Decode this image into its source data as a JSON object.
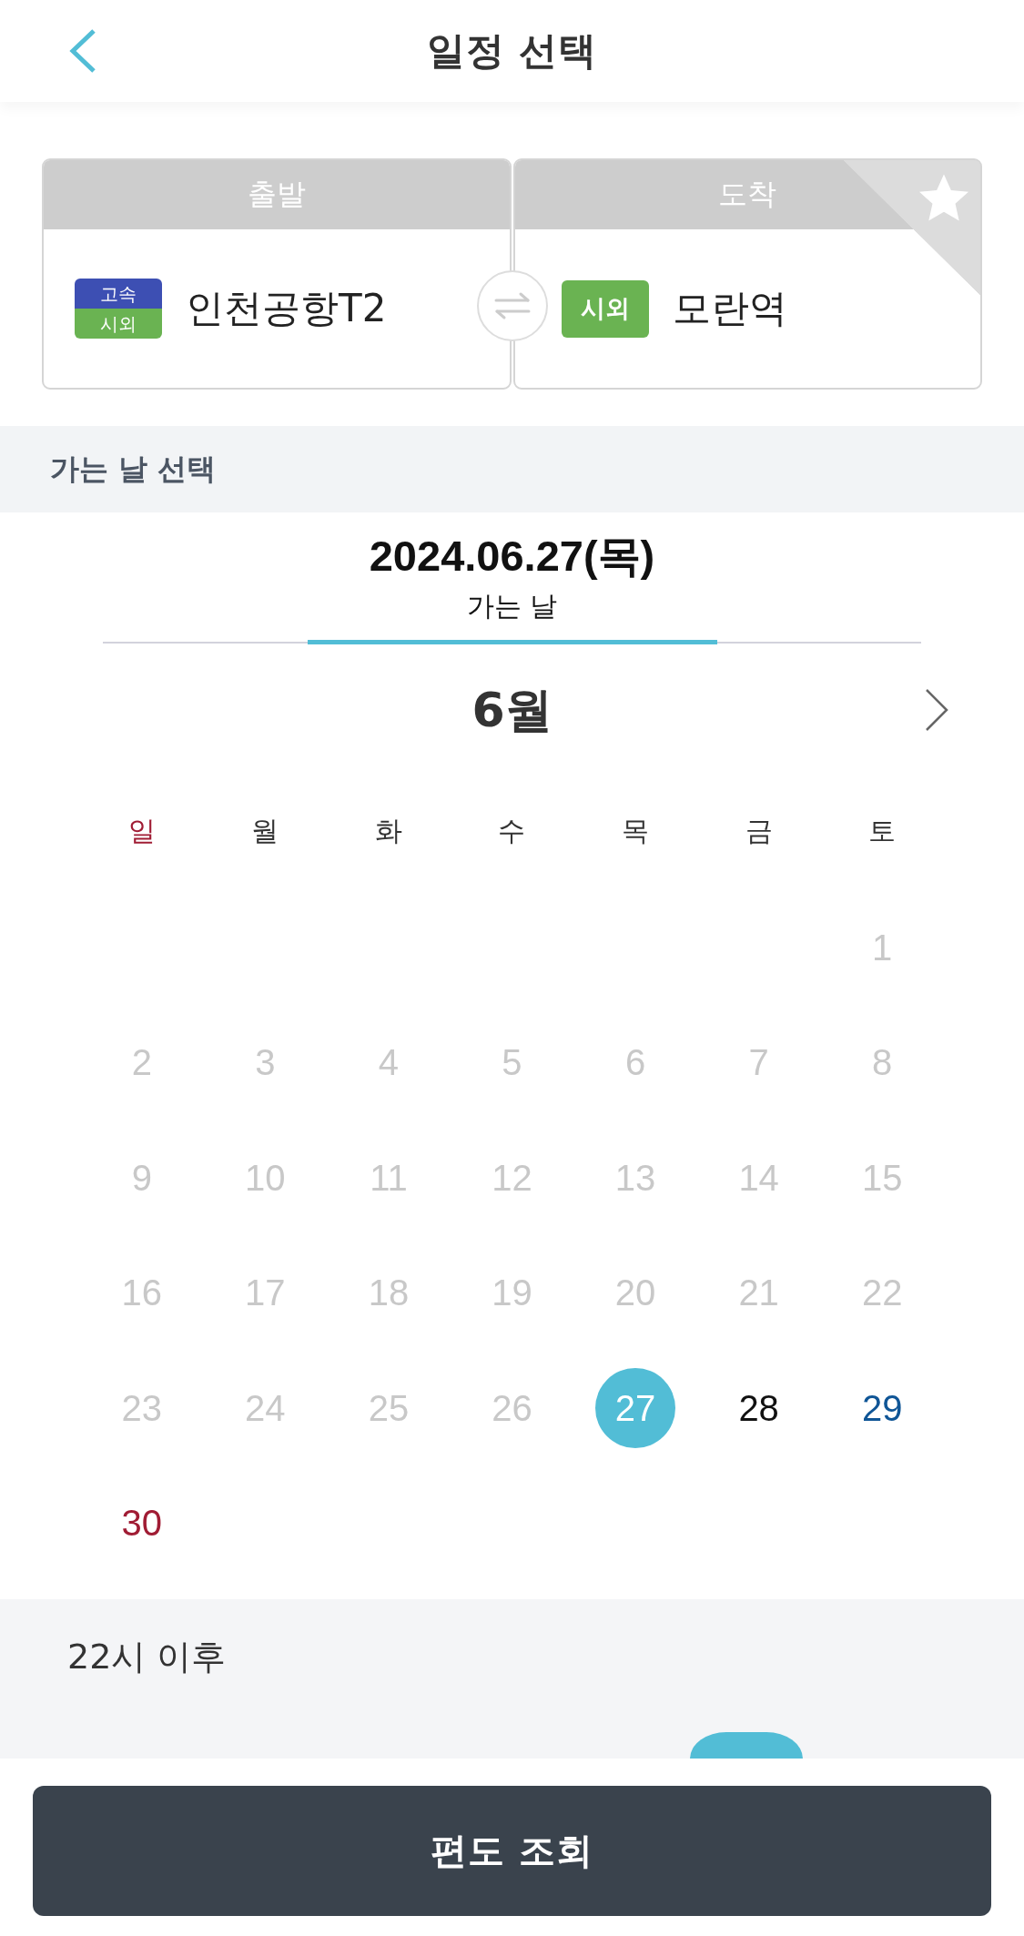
{
  "header": {
    "title": "일정 선택"
  },
  "route": {
    "departure": {
      "label": "출발",
      "badges": [
        {
          "text": "고속",
          "color": "#3d4fb3"
        },
        {
          "text": "시외",
          "color": "#6ab352"
        }
      ],
      "name": "인천공항T2"
    },
    "arrival": {
      "label": "도착",
      "badges": [
        {
          "text": "시외",
          "color": "#6ab352"
        }
      ],
      "name": "모란역",
      "favorite": false
    }
  },
  "section_title": "가는 날 선택",
  "trip_tab": {
    "date": "2024.06.27(목)",
    "label": "가는 날",
    "selected": true
  },
  "calendar": {
    "month": "6월",
    "weekdays": [
      {
        "label": "일",
        "kind": "sunday"
      },
      {
        "label": "월",
        "kind": "weekday"
      },
      {
        "label": "화",
        "kind": "weekday"
      },
      {
        "label": "수",
        "kind": "weekday"
      },
      {
        "label": "목",
        "kind": "weekday"
      },
      {
        "label": "금",
        "kind": "weekday"
      },
      {
        "label": "토",
        "kind": "weekday"
      }
    ],
    "weeks": [
      [
        {
          "kind": "blank"
        },
        {
          "kind": "blank"
        },
        {
          "kind": "blank"
        },
        {
          "kind": "blank"
        },
        {
          "kind": "blank"
        },
        {
          "kind": "blank"
        },
        {
          "label": "1",
          "kind": "saturday",
          "disabled": true,
          "selected": false
        }
      ],
      [
        {
          "label": "2",
          "kind": "sunday",
          "disabled": true,
          "selected": false
        },
        {
          "label": "3",
          "kind": "weekday",
          "disabled": true,
          "selected": false
        },
        {
          "label": "4",
          "kind": "weekday",
          "disabled": true,
          "selected": false
        },
        {
          "label": "5",
          "kind": "weekday",
          "disabled": true,
          "selected": false
        },
        {
          "label": "6",
          "kind": "weekday",
          "disabled": true,
          "selected": false
        },
        {
          "label": "7",
          "kind": "weekday",
          "disabled": true,
          "selected": false
        },
        {
          "label": "8",
          "kind": "saturday",
          "disabled": true,
          "selected": false
        }
      ],
      [
        {
          "label": "9",
          "kind": "sunday",
          "disabled": true,
          "selected": false
        },
        {
          "label": "10",
          "kind": "weekday",
          "disabled": true,
          "selected": false
        },
        {
          "label": "11",
          "kind": "weekday",
          "disabled": true,
          "selected": false
        },
        {
          "label": "12",
          "kind": "weekday",
          "disabled": true,
          "selected": false
        },
        {
          "label": "13",
          "kind": "weekday",
          "disabled": true,
          "selected": false
        },
        {
          "label": "14",
          "kind": "weekday",
          "disabled": true,
          "selected": false
        },
        {
          "label": "15",
          "kind": "saturday",
          "disabled": true,
          "selected": false
        }
      ],
      [
        {
          "label": "16",
          "kind": "sunday",
          "disabled": true,
          "selected": false
        },
        {
          "label": "17",
          "kind": "weekday",
          "disabled": true,
          "selected": false
        },
        {
          "label": "18",
          "kind": "weekday",
          "disabled": true,
          "selected": false
        },
        {
          "label": "19",
          "kind": "weekday",
          "disabled": true,
          "selected": false
        },
        {
          "label": "20",
          "kind": "weekday",
          "disabled": true,
          "selected": false
        },
        {
          "label": "21",
          "kind": "weekday",
          "disabled": true,
          "selected": false
        },
        {
          "label": "22",
          "kind": "saturday",
          "disabled": true,
          "selected": false
        }
      ],
      [
        {
          "label": "23",
          "kind": "sunday",
          "disabled": true,
          "selected": false
        },
        {
          "label": "24",
          "kind": "weekday",
          "disabled": true,
          "selected": false
        },
        {
          "label": "25",
          "kind": "weekday",
          "disabled": true,
          "selected": false
        },
        {
          "label": "26",
          "kind": "weekday",
          "disabled": true,
          "selected": false
        },
        {
          "label": "27",
          "kind": "weekday",
          "disabled": false,
          "selected": true
        },
        {
          "label": "28",
          "kind": "weekday",
          "disabled": false,
          "selected": false
        },
        {
          "label": "29",
          "kind": "saturday",
          "disabled": false,
          "selected": false
        }
      ],
      [
        {
          "label": "30",
          "kind": "sunday",
          "disabled": false,
          "selected": false
        }
      ]
    ]
  },
  "late_section": {
    "title": "22시 이후",
    "slots": [
      {
        "selected": true
      }
    ]
  },
  "search_button": "편도 조회"
}
